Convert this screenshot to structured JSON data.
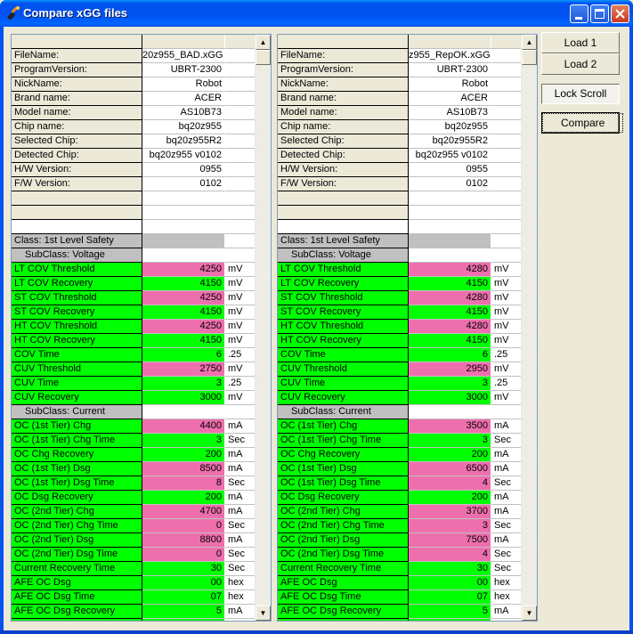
{
  "window": {
    "title": "Compare xGG files",
    "controls": [
      "minimize",
      "maximize",
      "close"
    ]
  },
  "buttons": {
    "load1": "Load 1",
    "load2": "Load 2",
    "lock_scroll": "Lock Scroll",
    "compare": "Compare"
  },
  "colors": {
    "match": "#00ff00",
    "diff": "#ee6fad",
    "class_header": "#c0c0c0"
  },
  "left": {
    "rows": [
      {
        "name": "",
        "value": "",
        "unit": "",
        "type": "header"
      },
      {
        "name": "FileName:",
        "value": "20z955_BAD.xGG",
        "unit": "",
        "type": "info"
      },
      {
        "name": "ProgramVersion:",
        "value": "UBRT-2300",
        "unit": "",
        "type": "info"
      },
      {
        "name": "NickName:",
        "value": "Robot",
        "unit": "",
        "type": "info"
      },
      {
        "name": "Brand name:",
        "value": "ACER",
        "unit": "",
        "type": "info"
      },
      {
        "name": "Model name:",
        "value": "AS10B73",
        "unit": "",
        "type": "info"
      },
      {
        "name": "Chip name:",
        "value": "bq20z955",
        "unit": "",
        "type": "info"
      },
      {
        "name": "Selected Chip:",
        "value": "bq20z955R2",
        "unit": "",
        "type": "info"
      },
      {
        "name": "Detected Chip:",
        "value": "bq20z955 v0102",
        "unit": "",
        "type": "info"
      },
      {
        "name": "H/W Version:",
        "value": "0955",
        "unit": "",
        "type": "info"
      },
      {
        "name": "F/W Version:",
        "value": "0102",
        "unit": "",
        "type": "info"
      },
      {
        "name": "",
        "value": "",
        "unit": "",
        "type": "info"
      },
      {
        "name": "",
        "value": "",
        "unit": "",
        "type": "info"
      },
      {
        "name": "",
        "value": "",
        "unit": "",
        "type": "blank"
      },
      {
        "name": "Class: 1st Level Safety",
        "value": "",
        "unit": "",
        "type": "class"
      },
      {
        "name": "SubClass: Voltage",
        "value": "",
        "unit": "",
        "type": "subclass"
      },
      {
        "name": "LT COV Threshold",
        "value": "4250",
        "unit": "mV",
        "type": "diff"
      },
      {
        "name": "LT COV Recovery",
        "value": "4150",
        "unit": "mV",
        "type": "match"
      },
      {
        "name": "ST COV Threshold",
        "value": "4250",
        "unit": "mV",
        "type": "diff"
      },
      {
        "name": "ST COV Recovery",
        "value": "4150",
        "unit": "mV",
        "type": "match"
      },
      {
        "name": "HT COV Threshold",
        "value": "4250",
        "unit": "mV",
        "type": "diff"
      },
      {
        "name": "HT COV Recovery",
        "value": "4150",
        "unit": "mV",
        "type": "match"
      },
      {
        "name": "COV Time",
        "value": "6",
        "unit": ".25",
        "type": "match"
      },
      {
        "name": "CUV Threshold",
        "value": "2750",
        "unit": "mV",
        "type": "diff"
      },
      {
        "name": "CUV Time",
        "value": "3",
        "unit": ".25",
        "type": "match"
      },
      {
        "name": "CUV Recovery",
        "value": "3000",
        "unit": "mV",
        "type": "match"
      },
      {
        "name": "SubClass: Current",
        "value": "",
        "unit": "",
        "type": "subclass"
      },
      {
        "name": "OC (1st Tier) Chg",
        "value": "4400",
        "unit": "mA",
        "type": "diff"
      },
      {
        "name": "OC (1st Tier) Chg Time",
        "value": "3",
        "unit": "Sec",
        "type": "match"
      },
      {
        "name": "OC Chg Recovery",
        "value": "200",
        "unit": "mA",
        "type": "match"
      },
      {
        "name": "OC (1st Tier) Dsg",
        "value": "8500",
        "unit": "mA",
        "type": "diff"
      },
      {
        "name": "OC (1st Tier) Dsg Time",
        "value": "8",
        "unit": "Sec",
        "type": "diff"
      },
      {
        "name": "OC Dsg Recovery",
        "value": "200",
        "unit": "mA",
        "type": "match"
      },
      {
        "name": "OC (2nd Tier) Chg",
        "value": "4700",
        "unit": "mA",
        "type": "diff"
      },
      {
        "name": "OC (2nd Tier) Chg Time",
        "value": "0",
        "unit": "Sec",
        "type": "diff"
      },
      {
        "name": "OC (2nd Tier) Dsg",
        "value": "8800",
        "unit": "mA",
        "type": "diff"
      },
      {
        "name": "OC (2nd Tier) Dsg Time",
        "value": "0",
        "unit": "Sec",
        "type": "diff"
      },
      {
        "name": "Current Recovery Time",
        "value": "30",
        "unit": "Sec",
        "type": "match"
      },
      {
        "name": "AFE OC Dsg",
        "value": "00",
        "unit": "hex",
        "type": "match"
      },
      {
        "name": "AFE OC Dsg Time",
        "value": "07",
        "unit": "hex",
        "type": "match"
      },
      {
        "name": "AFE OC Dsg Recovery",
        "value": "5",
        "unit": "mA",
        "type": "match"
      },
      {
        "name": "",
        "value": "",
        "unit": "",
        "type": "match"
      }
    ]
  },
  "right": {
    "rows": [
      {
        "name": "",
        "value": "",
        "unit": "",
        "type": "header"
      },
      {
        "name": "FileName:",
        "value": "z955_RepOK.xGG",
        "unit": "",
        "type": "info"
      },
      {
        "name": "ProgramVersion:",
        "value": "UBRT-2300",
        "unit": "",
        "type": "info"
      },
      {
        "name": "NickName:",
        "value": "Robot",
        "unit": "",
        "type": "info"
      },
      {
        "name": "Brand name:",
        "value": "ACER",
        "unit": "",
        "type": "info"
      },
      {
        "name": "Model name:",
        "value": "AS10B73",
        "unit": "",
        "type": "info"
      },
      {
        "name": "Chip name:",
        "value": "bq20z955",
        "unit": "",
        "type": "info"
      },
      {
        "name": "Selected Chip:",
        "value": "bq20z955R2",
        "unit": "",
        "type": "info"
      },
      {
        "name": "Detected Chip:",
        "value": "bq20z955 v0102",
        "unit": "",
        "type": "info"
      },
      {
        "name": "H/W Version:",
        "value": "0955",
        "unit": "",
        "type": "info"
      },
      {
        "name": "F/W Version:",
        "value": "0102",
        "unit": "",
        "type": "info"
      },
      {
        "name": "",
        "value": "",
        "unit": "",
        "type": "info"
      },
      {
        "name": "",
        "value": "",
        "unit": "",
        "type": "info"
      },
      {
        "name": "",
        "value": "",
        "unit": "",
        "type": "blank"
      },
      {
        "name": "Class: 1st Level Safety",
        "value": "",
        "unit": "",
        "type": "class"
      },
      {
        "name": "SubClass: Voltage",
        "value": "",
        "unit": "",
        "type": "subclass"
      },
      {
        "name": "LT COV Threshold",
        "value": "4280",
        "unit": "mV",
        "type": "diff"
      },
      {
        "name": "LT COV Recovery",
        "value": "4150",
        "unit": "mV",
        "type": "match"
      },
      {
        "name": "ST COV Threshold",
        "value": "4280",
        "unit": "mV",
        "type": "diff"
      },
      {
        "name": "ST COV Recovery",
        "value": "4150",
        "unit": "mV",
        "type": "match"
      },
      {
        "name": "HT COV Threshold",
        "value": "4280",
        "unit": "mV",
        "type": "diff"
      },
      {
        "name": "HT COV Recovery",
        "value": "4150",
        "unit": "mV",
        "type": "match"
      },
      {
        "name": "COV Time",
        "value": "6",
        "unit": ".25",
        "type": "match"
      },
      {
        "name": "CUV Threshold",
        "value": "2950",
        "unit": "mV",
        "type": "diff"
      },
      {
        "name": "CUV Time",
        "value": "3",
        "unit": ".25",
        "type": "match"
      },
      {
        "name": "CUV Recovery",
        "value": "3000",
        "unit": "mV",
        "type": "match"
      },
      {
        "name": "SubClass: Current",
        "value": "",
        "unit": "",
        "type": "subclass"
      },
      {
        "name": "OC (1st Tier) Chg",
        "value": "3500",
        "unit": "mA",
        "type": "diff"
      },
      {
        "name": "OC (1st Tier) Chg Time",
        "value": "3",
        "unit": "Sec",
        "type": "match"
      },
      {
        "name": "OC Chg Recovery",
        "value": "200",
        "unit": "mA",
        "type": "match"
      },
      {
        "name": "OC (1st Tier) Dsg",
        "value": "6500",
        "unit": "mA",
        "type": "diff"
      },
      {
        "name": "OC (1st Tier) Dsg Time",
        "value": "4",
        "unit": "Sec",
        "type": "diff"
      },
      {
        "name": "OC Dsg Recovery",
        "value": "200",
        "unit": "mA",
        "type": "match"
      },
      {
        "name": "OC (2nd Tier) Chg",
        "value": "3700",
        "unit": "mA",
        "type": "diff"
      },
      {
        "name": "OC (2nd Tier) Chg Time",
        "value": "3",
        "unit": "Sec",
        "type": "diff"
      },
      {
        "name": "OC (2nd Tier) Dsg",
        "value": "7500",
        "unit": "mA",
        "type": "diff"
      },
      {
        "name": "OC (2nd Tier) Dsg Time",
        "value": "4",
        "unit": "Sec",
        "type": "diff"
      },
      {
        "name": "Current Recovery Time",
        "value": "30",
        "unit": "Sec",
        "type": "match"
      },
      {
        "name": "AFE OC Dsg",
        "value": "00",
        "unit": "hex",
        "type": "match"
      },
      {
        "name": "AFE OC Dsg Time",
        "value": "07",
        "unit": "hex",
        "type": "match"
      },
      {
        "name": "AFE OC Dsg Recovery",
        "value": "5",
        "unit": "mA",
        "type": "match"
      },
      {
        "name": "",
        "value": "",
        "unit": "",
        "type": "match"
      }
    ]
  }
}
